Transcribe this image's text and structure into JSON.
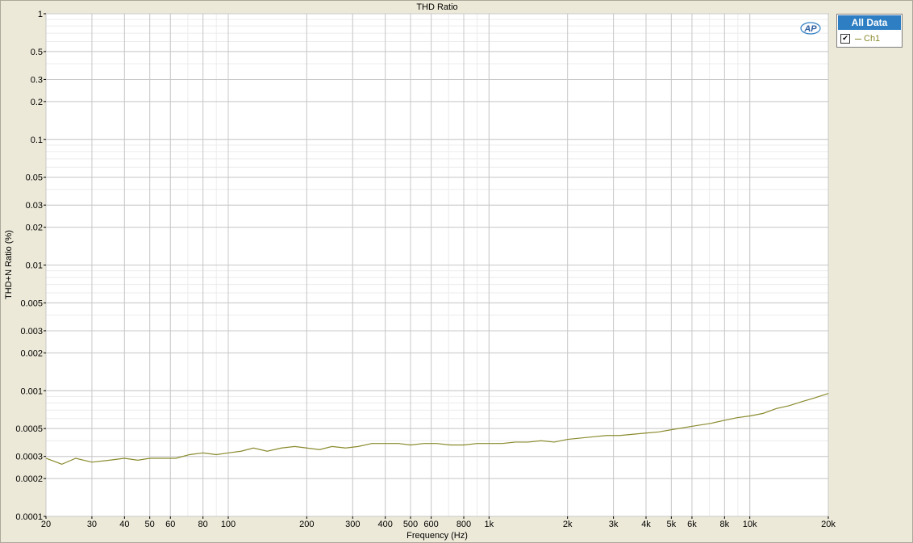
{
  "chart_data": {
    "type": "line",
    "title": "THD Ratio",
    "xlabel": "Frequency (Hz)",
    "ylabel": "THD+N Ratio (%)",
    "x_scale": "log",
    "y_scale": "log",
    "xlim": [
      20,
      20000
    ],
    "ylim": [
      0.0001,
      1
    ],
    "grid": true,
    "legend_position": "top-right",
    "x_ticks": [
      {
        "v": 20,
        "l": "20"
      },
      {
        "v": 30,
        "l": "30"
      },
      {
        "v": 40,
        "l": "40"
      },
      {
        "v": 50,
        "l": "50"
      },
      {
        "v": 60,
        "l": "60"
      },
      {
        "v": 80,
        "l": "80"
      },
      {
        "v": 100,
        "l": "100"
      },
      {
        "v": 200,
        "l": "200"
      },
      {
        "v": 300,
        "l": "300"
      },
      {
        "v": 400,
        "l": "400"
      },
      {
        "v": 500,
        "l": "500"
      },
      {
        "v": 600,
        "l": "600"
      },
      {
        "v": 800,
        "l": "800"
      },
      {
        "v": 1000,
        "l": "1k"
      },
      {
        "v": 2000,
        "l": "2k"
      },
      {
        "v": 3000,
        "l": "3k"
      },
      {
        "v": 4000,
        "l": "4k"
      },
      {
        "v": 5000,
        "l": "5k"
      },
      {
        "v": 6000,
        "l": "6k"
      },
      {
        "v": 8000,
        "l": "8k"
      },
      {
        "v": 10000,
        "l": "10k"
      },
      {
        "v": 20000,
        "l": "20k"
      }
    ],
    "y_ticks": [
      {
        "v": 1,
        "l": "1"
      },
      {
        "v": 0.5,
        "l": "0.5"
      },
      {
        "v": 0.3,
        "l": "0.3"
      },
      {
        "v": 0.2,
        "l": "0.2"
      },
      {
        "v": 0.1,
        "l": "0.1"
      },
      {
        "v": 0.05,
        "l": "0.05"
      },
      {
        "v": 0.03,
        "l": "0.03"
      },
      {
        "v": 0.02,
        "l": "0.02"
      },
      {
        "v": 0.01,
        "l": "0.01"
      },
      {
        "v": 0.005,
        "l": "0.005"
      },
      {
        "v": 0.003,
        "l": "0.003"
      },
      {
        "v": 0.002,
        "l": "0.002"
      },
      {
        "v": 0.001,
        "l": "0.001"
      },
      {
        "v": 0.0005,
        "l": "0.0005"
      },
      {
        "v": 0.0003,
        "l": "0.0003"
      },
      {
        "v": 0.0002,
        "l": "0.0002"
      },
      {
        "v": 0.0001,
        "l": "0.0001"
      }
    ],
    "series": [
      {
        "name": "Ch1",
        "color": "#8a8a2e",
        "x": [
          20,
          23,
          26,
          30,
          35,
          40,
          45,
          50,
          56,
          63,
          71,
          80,
          90,
          100,
          112,
          125,
          141,
          160,
          180,
          200,
          224,
          250,
          282,
          315,
          355,
          400,
          450,
          500,
          562,
          630,
          710,
          800,
          900,
          1000,
          1122,
          1260,
          1413,
          1585,
          1778,
          2000,
          2244,
          2520,
          2825,
          3170,
          3557,
          3990,
          4477,
          5024,
          5637,
          6325,
          7096,
          7962,
          8934,
          10020,
          11243,
          12616,
          14155,
          15882,
          17820,
          20000
        ],
        "y": [
          0.00029,
          0.00026,
          0.00029,
          0.00027,
          0.00028,
          0.00029,
          0.00028,
          0.00029,
          0.00029,
          0.00029,
          0.00031,
          0.00032,
          0.00031,
          0.00032,
          0.00033,
          0.00035,
          0.00033,
          0.00035,
          0.00036,
          0.00035,
          0.00034,
          0.00036,
          0.00035,
          0.00036,
          0.00038,
          0.00038,
          0.00038,
          0.00037,
          0.00038,
          0.00038,
          0.00037,
          0.00037,
          0.00038,
          0.00038,
          0.00038,
          0.00039,
          0.00039,
          0.0004,
          0.00039,
          0.00041,
          0.00042,
          0.00043,
          0.00044,
          0.00044,
          0.00045,
          0.00046,
          0.00047,
          0.00049,
          0.00051,
          0.00053,
          0.00055,
          0.00058,
          0.00061,
          0.00063,
          0.00066,
          0.00072,
          0.00076,
          0.00082,
          0.00088,
          0.00095
        ]
      }
    ]
  },
  "legend": {
    "header": "All Data",
    "items": [
      {
        "label": "Ch1",
        "checked": true,
        "check_glyph": "✔"
      }
    ]
  },
  "logo": {
    "text": "AP",
    "icon": "audio-precision-logo"
  }
}
